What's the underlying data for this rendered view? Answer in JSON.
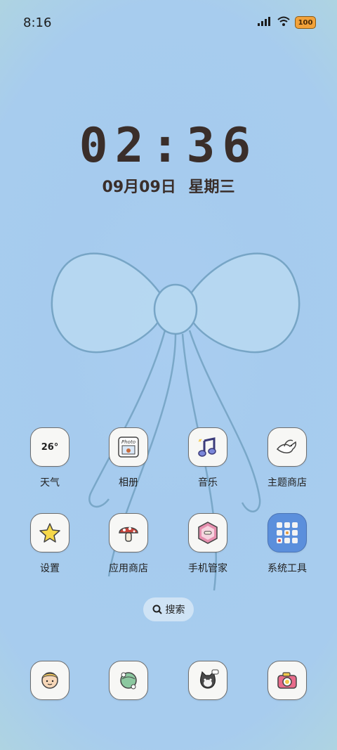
{
  "status_bar": {
    "time": "8:16",
    "battery": "100",
    "icons": [
      "signal-icon",
      "wifi-icon",
      "battery-icon"
    ]
  },
  "lock_clock": {
    "time": "02:36",
    "date": "09月09日",
    "weekday": "星期三"
  },
  "apps_row1": [
    {
      "label": "天气",
      "icon": "weather-icon",
      "text": "26°"
    },
    {
      "label": "相册",
      "icon": "photo-icon",
      "text": "Photo"
    },
    {
      "label": "音乐",
      "icon": "music-note-icon"
    },
    {
      "label": "主题商店",
      "icon": "dove-icon"
    }
  ],
  "apps_row2": [
    {
      "label": "设置",
      "icon": "star-icon"
    },
    {
      "label": "应用商店",
      "icon": "mushroom-icon"
    },
    {
      "label": "手机管家",
      "icon": "shield-bone-icon"
    },
    {
      "label": "系统工具",
      "icon": "folder-icon"
    }
  ],
  "search": {
    "label": "搜索"
  },
  "dock": [
    {
      "icon": "phone-cherub-icon"
    },
    {
      "icon": "messages-globe-icon"
    },
    {
      "icon": "browser-cat-icon"
    },
    {
      "icon": "camera-icon"
    }
  ],
  "colors": {
    "background": "#a7ccee",
    "clock_text": "#3a2e2a",
    "icon_bg": "#f7f7f5"
  }
}
